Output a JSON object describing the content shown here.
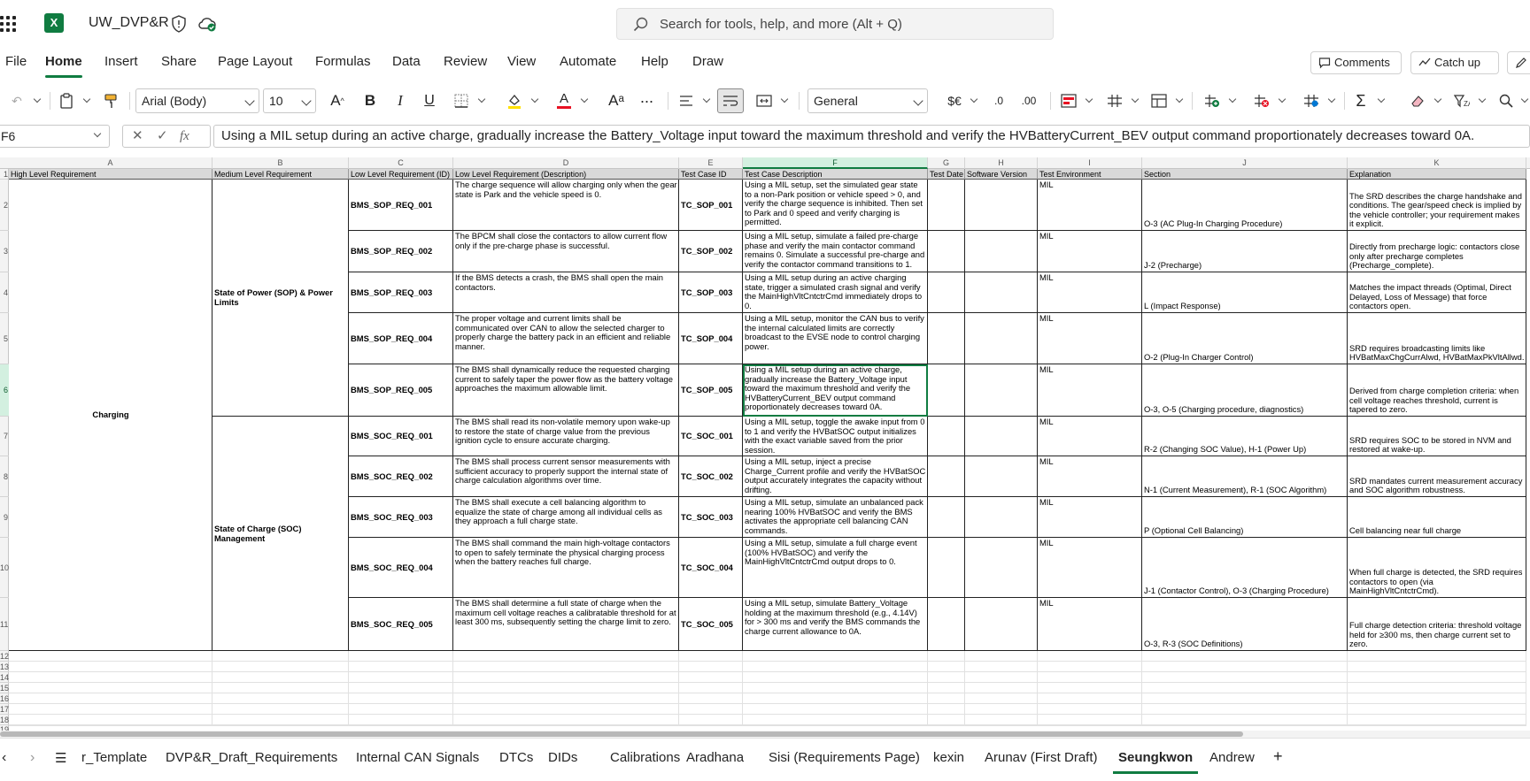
{
  "app": {
    "filename": "UW_DVP&R",
    "search_placeholder": "Search for tools, help, and more (Alt + Q)",
    "brand_color": "#107c41"
  },
  "menu": {
    "tabs": [
      "File",
      "Home",
      "Insert",
      "Share",
      "Page Layout",
      "Formulas",
      "Data",
      "Review",
      "View",
      "Automate",
      "Help",
      "Draw"
    ],
    "active": "Home",
    "comments": "Comments",
    "catch_up": "Catch up"
  },
  "ribbon": {
    "font_name": "Arial (Body)",
    "font_size": "10",
    "number_format": "General",
    "currency": "$€",
    "dec_decrease": ".0",
    "dec_increase": ".00"
  },
  "formula_bar": {
    "name_box": "F6",
    "fx": "fx",
    "content": "Using a MIL setup during an active charge, gradually increase the Battery_Voltage input toward the maximum threshold and verify the HVBatteryCurrent_BEV output command proportionately decreases toward 0A."
  },
  "sheet": {
    "columns": [
      "A",
      "B",
      "C",
      "D",
      "E",
      "F",
      "G",
      "H",
      "I",
      "J",
      "K"
    ],
    "selected_column": "F",
    "selected_row": "6",
    "row_numbers": [
      "1",
      "2",
      "3",
      "4",
      "5",
      "6",
      "7",
      "8",
      "9",
      "10",
      "11",
      "12",
      "13",
      "14",
      "15",
      "16",
      "17",
      "18",
      "19"
    ],
    "headers": [
      "High Level Requirement",
      "Medium Level Requirement",
      "Low Level Requirement (ID)",
      "Low Level Requirement (Description)",
      "Test Case ID",
      "Test Case Description",
      "Test Date",
      "Software Version",
      "Test Environment",
      "Section",
      "Explanation"
    ],
    "high_level": "Charging",
    "medium_sop": "State of Power (SOP) & Power Limits",
    "medium_soc": "State of Charge (SOC) Management",
    "rows": [
      {
        "id": "BMS_SOP_REQ_001",
        "desc": "The charge sequence will allow charging only when the gear state is Park and the vehicle speed is 0.",
        "tc": "TC_SOP_001",
        "tcdesc": "Using a MIL setup, set the simulated gear state to a non-Park position or vehicle speed > 0, and verify the charge sequence is inhibited. Then set to Park and 0 speed and verify charging is permitted.",
        "env": "MIL",
        "section": "O-3 (AC Plug-In Charging Procedure)",
        "expl": "The SRD describes the charge handshake and conditions. The gear/speed check is implied by the vehicle controller; your requirement makes it explicit."
      },
      {
        "id": "BMS_SOP_REQ_002",
        "desc": "The BPCM shall close the contactors to allow current flow only if the pre-charge phase is successful.",
        "tc": "TC_SOP_002",
        "tcdesc": "Using a MIL setup, simulate a failed pre-charge phase and verify the main contactor command remains 0. Simulate a successful pre-charge and verify the contactor command transitions to 1.",
        "env": "MIL",
        "section": "J-2 (Precharge)",
        "expl": "Directly from precharge logic: contactors close only after precharge completes (Precharge_complete)."
      },
      {
        "id": "BMS_SOP_REQ_003",
        "desc": "If the BMS detects a crash, the BMS shall open the main contactors.",
        "tc": "TC_SOP_003",
        "tcdesc": "Using a MIL setup during an active charging state, trigger a simulated crash signal and verify the MainHighVltCntctrCmd immediately drops to 0.",
        "env": "MIL",
        "section": "L (Impact Response)",
        "expl": "Matches the impact threads (Optimal, Direct Delayed, Loss of Message) that force contactors open."
      },
      {
        "id": "BMS_SOP_REQ_004",
        "desc": "The proper voltage and current limits shall be communicated over CAN to allow the selected charger to properly charge the battery pack in an efficient and reliable manner.",
        "tc": "TC_SOP_004",
        "tcdesc": "Using a MIL setup, monitor the CAN bus to verify the internal calculated limits are correctly broadcast to the EVSE node to control charging power.",
        "env": "MIL",
        "section": "O-2 (Plug-In Charger Control)",
        "expl": "SRD requires broadcasting limits like HVBatMaxChgCurrAlwd, HVBatMaxPkVltAllwd."
      },
      {
        "id": "BMS_SOP_REQ_005",
        "desc": "The BMS shall dynamically reduce the requested charging current to safely taper the power flow as the battery voltage approaches the maximum allowable limit.",
        "tc": "TC_SOP_005",
        "tcdesc": "Using a MIL setup during an active charge, gradually increase the Battery_Voltage input toward the maximum threshold and verify the HVBatteryCurrent_BEV output command proportionately decreases toward 0A.",
        "env": "MIL",
        "section": "O-3, O-5 (Charging procedure, diagnostics)",
        "expl": "Derived from charge completion criteria: when cell voltage reaches threshold, current is tapered to zero."
      },
      {
        "id": "BMS_SOC_REQ_001",
        "desc": "The BMS shall read its non-volatile memory upon wake-up to restore the state of charge value from the previous ignition cycle to ensure accurate charging.",
        "tc": "TC_SOC_001",
        "tcdesc": "Using a MIL setup, toggle the awake input from 0 to 1 and verify the HVBatSOC output initializes with the exact variable saved from the prior session.",
        "env": "MIL",
        "section": "R-2 (Changing SOC Value), H-1 (Power Up)",
        "expl": "SRD requires SOC to be stored in NVM and restored at wake-up."
      },
      {
        "id": "BMS_SOC_REQ_002",
        "desc": "The BMS shall process current sensor measurements with sufficient accuracy to properly support the internal state of charge calculation algorithms over time.",
        "tc": "TC_SOC_002",
        "tcdesc": "Using a MIL setup, inject a precise Charge_Current profile and verify the HVBatSOC output accurately integrates the capacity without drifting.",
        "env": "MIL",
        "section": "N-1 (Current Measurement), R-1 (SOC Algorithm)",
        "expl": "SRD mandates current measurement accuracy and SOC algorithm robustness."
      },
      {
        "id": "BMS_SOC_REQ_003",
        "desc": "The BMS shall execute a cell balancing algorithm to equalize the state of charge among all individual cells as they approach a full charge state.",
        "tc": "TC_SOC_003",
        "tcdesc": "Using a MIL setup, simulate an unbalanced pack nearing 100% HVBatSOC and verify the BMS activates the appropriate cell balancing CAN commands.",
        "env": "MIL",
        "section": "P (Optional Cell Balancing)",
        "expl": "Cell balancing near full charge"
      },
      {
        "id": "BMS_SOC_REQ_004",
        "desc": "The BMS shall command the main high-voltage contactors to open to safely terminate the physical charging process when the battery reaches full charge.",
        "tc": "TC_SOC_004",
        "tcdesc": "Using a MIL setup, simulate a full charge event (100% HVBatSOC) and verify the MainHighVltCntctrCmd output drops to 0.",
        "env": "MIL",
        "section": "J-1 (Contactor Control), O-3 (Charging Procedure)",
        "expl": "When full charge is detected, the SRD requires contactors to open (via MainHighVltCntctrCmd)."
      },
      {
        "id": "BMS_SOC_REQ_005",
        "desc": "The BMS shall determine a full state of charge when the maximum cell voltage reaches a calibratable threshold for at least 300 ms, subsequently setting the charge limit to zero.",
        "tc": "TC_SOC_005",
        "tcdesc": "Using a MIL setup, simulate Battery_Voltage holding at the maximum threshold (e.g., 4.14V) for > 300 ms and verify the BMS commands the charge current allowance to 0A.",
        "env": "MIL",
        "section": "O-3, R-3 (SOC Definitions)",
        "expl": "Full charge detection criteria: threshold voltage held for ≥300 ms, then charge current set to zero."
      }
    ]
  },
  "sheet_tabs": {
    "tabs": [
      "r_Template",
      "DVP&R_Draft_Requirements",
      "Internal CAN Signals",
      "DTCs",
      "DIDs",
      "Calibrations",
      "Aradhana",
      "Sisi (Requirements Page)",
      "kexin",
      "Arunav (First Draft)",
      "Seungkwon",
      "Andrew"
    ],
    "active": "Seungkwon",
    "add": "+"
  }
}
